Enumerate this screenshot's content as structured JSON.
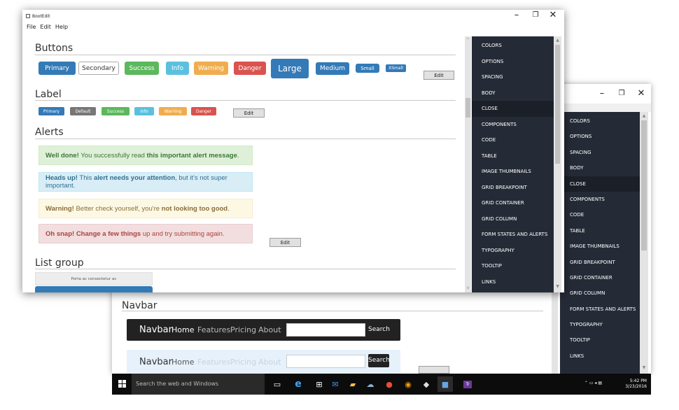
{
  "front_window": {
    "title": "BootEdit",
    "menu": [
      "File",
      "Edit",
      "Help"
    ],
    "controls": {
      "minimize": "–",
      "maximize": "❐",
      "close": "✕"
    },
    "buttons_section": {
      "title": "Buttons",
      "buttons": [
        {
          "label": "Primary",
          "color": "#337ab7"
        },
        {
          "label": "Secondary",
          "color": "#ffffff"
        },
        {
          "label": "Success",
          "color": "#5cb85c"
        },
        {
          "label": "Info",
          "color": "#5bc0de"
        },
        {
          "label": "Warning",
          "color": "#f0ad4e"
        },
        {
          "label": "Danger",
          "color": "#d9534f"
        },
        {
          "label": "Large",
          "color": "#337ab7"
        },
        {
          "label": "Medium",
          "color": "#337ab7"
        },
        {
          "label": "Small",
          "color": "#337ab7"
        },
        {
          "label": "XSmall",
          "color": "#337ab7"
        }
      ],
      "edit": "Edit"
    },
    "label_section": {
      "title": "Label",
      "labels": [
        "Primary",
        "Default",
        "Success",
        "Info",
        "Warning",
        "Danger"
      ],
      "edit": "Edit"
    },
    "alerts_section": {
      "title": "Alerts",
      "alerts": [
        {
          "strong": "Well done!",
          "text1": " You successfully read ",
          "bold2": "this important alert message",
          "text2": "."
        },
        {
          "strong": "Heads up!",
          "text1": " This ",
          "bold2": "alert needs your attention",
          "text2": ", but it's not super important."
        },
        {
          "strong": "Warning!",
          "text1": " Better check yourself, you're ",
          "bold2": "not looking too good",
          "text2": "."
        },
        {
          "strong": "Oh snap!",
          "text1": " ",
          "bold2": "Change a few things",
          "text2": " up and try submitting again."
        }
      ],
      "edit": "Edit"
    },
    "list_group_section": {
      "title": "List group",
      "items": [
        "Porta ac consectetur ac"
      ]
    },
    "sidebar": {
      "items": [
        "COLORS",
        "OPTIONS",
        "SPACING",
        "BODY",
        "CLOSE",
        "COMPONENTS",
        "CODE",
        "TABLE",
        "IMAGE THUMBNAILS",
        "GRID BREAKPOINT",
        "GRID CONTAINER",
        "GRID COLUMN",
        "FORM STATES AND ALERTS",
        "TYPOGRAPHY",
        "TOOLTIP",
        "LINKS"
      ],
      "active": "CLOSE"
    }
  },
  "back_window": {
    "controls": {
      "minimize": "–",
      "maximize": "❐",
      "close": "✕"
    },
    "navbar_section": {
      "title": "Navbar",
      "dark_navbar": {
        "brand": "Navbar",
        "links": [
          "Home",
          "Features",
          "Pricing",
          "About"
        ],
        "search_button": "Search"
      },
      "light_navbar": {
        "brand": "Navbar",
        "links": [
          "Home",
          "Features",
          "Pricing",
          "About"
        ],
        "search_button": "Search"
      }
    },
    "sidebar": {
      "items": [
        "COLORS",
        "OPTIONS",
        "SPACING",
        "BODY",
        "CLOSE",
        "COMPONENTS",
        "CODE",
        "TABLE",
        "IMAGE THUMBNAILS",
        "GRID BREAKPOINT",
        "GRID CONTAINER",
        "GRID COLUMN",
        "FORM STATES AND ALERTS",
        "TYPOGRAPHY",
        "TOOLTIP",
        "LINKS"
      ],
      "active": "CLOSE"
    }
  },
  "taskbar": {
    "search_placeholder": "Search the web and Windows",
    "time": "5:42 PM",
    "date": "3/23/2016",
    "icons": [
      "start-icon",
      "task-view-icon",
      "edge-icon",
      "store-icon",
      "mail-icon",
      "file-explorer-icon",
      "network-icon",
      "chrome-icon",
      "firefox-icon",
      "app-icon",
      "visual-studio-icon",
      "tr-icon"
    ]
  }
}
